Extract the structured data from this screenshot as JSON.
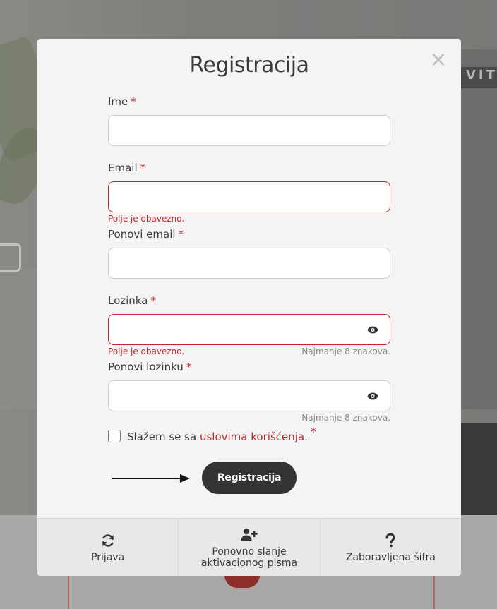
{
  "modal": {
    "title": "Registracija",
    "close_symbol": "×",
    "required_marker": "*"
  },
  "fields": {
    "name": {
      "label": "Ime",
      "value": "",
      "error": ""
    },
    "email": {
      "label": "Email",
      "value": "",
      "error": "Polje je obavezno."
    },
    "repeat_email": {
      "label": "Ponovi email",
      "value": ""
    },
    "password": {
      "label": "Lozinka",
      "value": "",
      "error": "Polje je obavezno.",
      "hint": "Najmanje 8 znakova.",
      "toggle_icon": "eye-icon"
    },
    "repeat_password": {
      "label": "Ponovi lozinku",
      "value": "",
      "hint": "Najmanje 8 znakova.",
      "toggle_icon": "eye-icon"
    }
  },
  "terms": {
    "checked": false,
    "prefix": "Slažem se sa ",
    "link_text": "uslovima korišćenja",
    "suffix": ".",
    "required_marker": "*"
  },
  "submit": {
    "label": "Registracija"
  },
  "footer": [
    {
      "icon": "sync-icon",
      "label": "Prijava"
    },
    {
      "icon": "user-plus-icon",
      "label_line1": "Ponovno slanje",
      "label_line2": "aktivacionog pisma"
    },
    {
      "icon": "question-icon",
      "label": "Zaboravljena šifra"
    }
  ],
  "colors": {
    "accent_red": "#c0272d",
    "button_dark": "#333333",
    "modal_bg": "#f4f4f4",
    "footer_bg": "#e8e8e8"
  },
  "background": {
    "brand_text": "VIT"
  }
}
